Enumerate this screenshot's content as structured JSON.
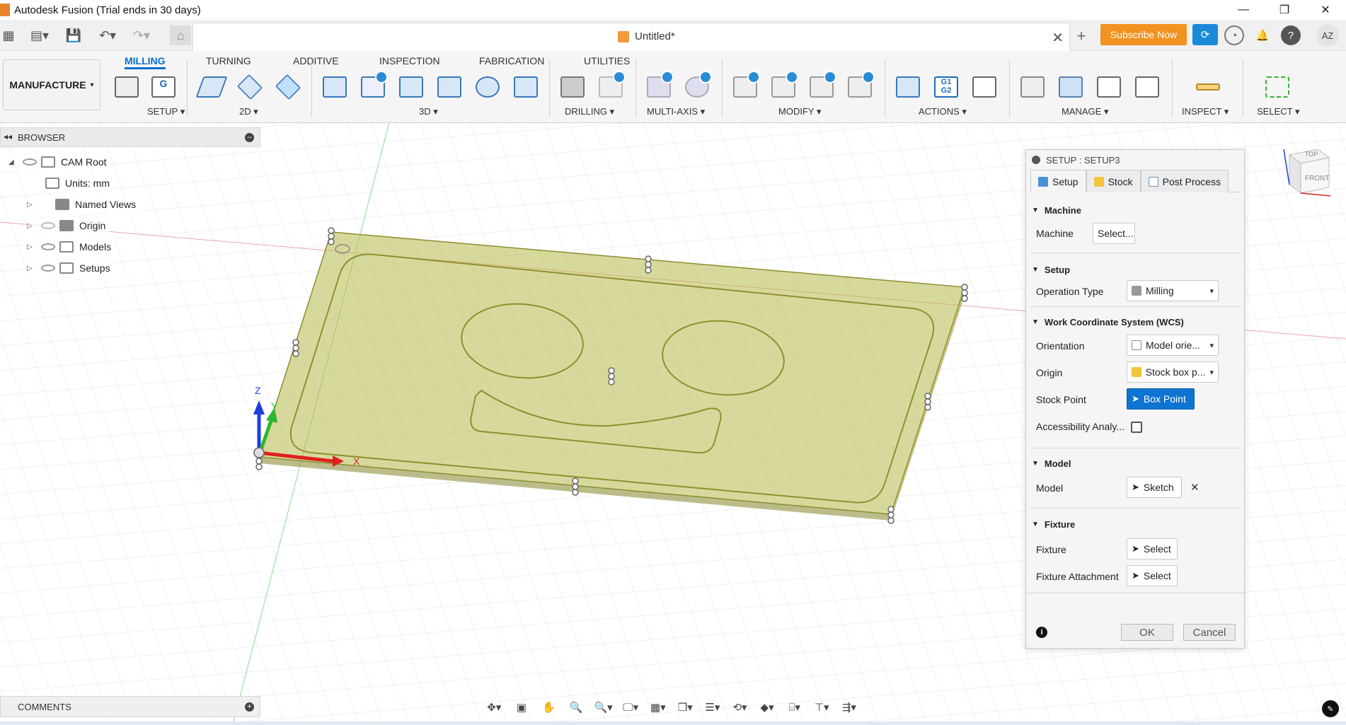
{
  "window": {
    "title": "Autodesk Fusion (Trial ends in 30 days)",
    "controls": [
      "—",
      "❐",
      "✕"
    ]
  },
  "document": {
    "title": "Untitled*",
    "subscribe_label": "Subscribe Now",
    "avatar": "AZ"
  },
  "toolbar": {
    "workspace": "MANUFACTURE",
    "tabs": [
      "MILLING",
      "TURNING",
      "ADDITIVE",
      "INSPECTION",
      "FABRICATION",
      "UTILITIES"
    ],
    "active_tab": "MILLING",
    "groups": [
      {
        "label": "SETUP ▾"
      },
      {
        "label": "2D ▾"
      },
      {
        "label": "3D ▾"
      },
      {
        "label": "DRILLING ▾"
      },
      {
        "label": "MULTI-AXIS ▾"
      },
      {
        "label": "MODIFY ▾"
      },
      {
        "label": "ACTIONS ▾"
      },
      {
        "label": "MANAGE ▾"
      },
      {
        "label": "INSPECT ▾"
      },
      {
        "label": "SELECT ▾"
      }
    ],
    "nc_label": "G1\nG2",
    "g_label": "G"
  },
  "browser": {
    "title": "BROWSER",
    "nodes": [
      {
        "label": "CAM Root"
      },
      {
        "label": "Units: mm"
      },
      {
        "label": "Named Views"
      },
      {
        "label": "Origin"
      },
      {
        "label": "Models"
      },
      {
        "label": "Setups"
      }
    ]
  },
  "comments": {
    "label": "COMMENTS"
  },
  "dialog": {
    "title": "SETUP : SETUP3",
    "tabs": [
      "Setup",
      "Stock",
      "Post Process"
    ],
    "sections": {
      "machine": {
        "title": "Machine",
        "label": "Machine",
        "button": "Select..."
      },
      "setup": {
        "title": "Setup",
        "label": "Operation Type",
        "value": "Milling"
      },
      "wcs": {
        "title": "Work Coordinate System (WCS)",
        "orientation_label": "Orientation",
        "orientation_value": "Model orie...",
        "origin_label": "Origin",
        "origin_value": "Stock box p...",
        "stock_point_label": "Stock Point",
        "stock_point_value": "Box Point",
        "accessibility_label": "Accessibility Analy..."
      },
      "model": {
        "title": "Model",
        "label": "Model",
        "value": "Sketch",
        "clear": "✕"
      },
      "fixture": {
        "title": "Fixture",
        "fixture_label": "Fixture",
        "fixture_value": "Select",
        "attachment_label": "Fixture Attachment",
        "attachment_value": "Select"
      }
    },
    "ok": "OK",
    "cancel": "Cancel",
    "info": "i"
  },
  "viewcube": {
    "top": "TOP",
    "front": "FRONT"
  },
  "axes": {
    "x": "X",
    "y": "Y",
    "z": "Z"
  },
  "colors": {
    "accent": "#0a6ed1",
    "subscribe": "#f29220",
    "stock_fill": "#b5b84a",
    "x_axis": "#e02020",
    "y_axis": "#2db82d",
    "z_axis": "#1c3fe0"
  }
}
